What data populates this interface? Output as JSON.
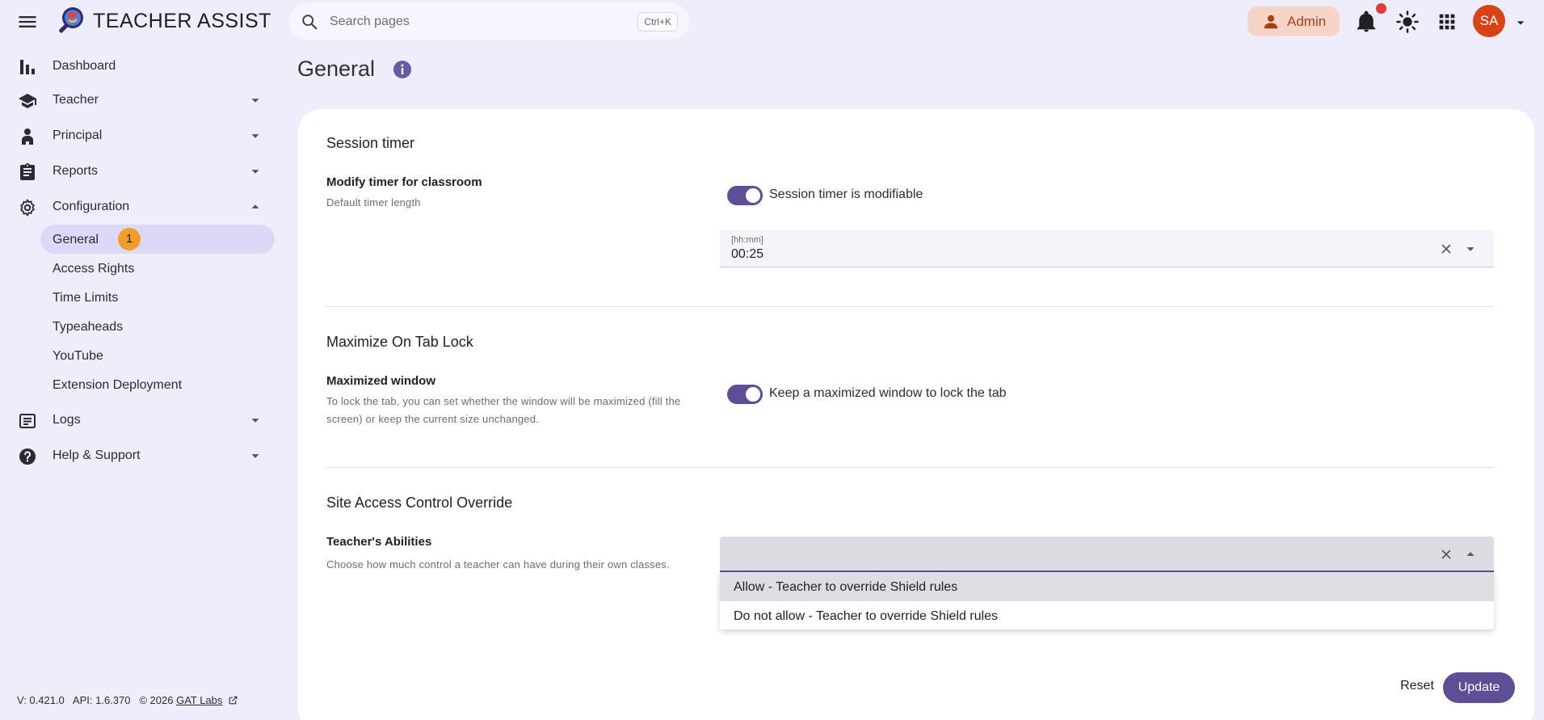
{
  "app": {
    "brand": "TEACHER ASSIST",
    "search_placeholder": "Search pages",
    "search_shortcut": "Ctrl+K",
    "role_label": "Admin",
    "avatar_initials": "SA",
    "icons": [
      "menu-icon",
      "app-logo-icon",
      "search-icon",
      "person-icon",
      "bell-icon",
      "sun-icon",
      "apps-grid-icon",
      "chevron-down-icon"
    ],
    "colors": {
      "accent": "#5d4e95",
      "admin_chip": "#f6d5c8",
      "avatar": "#d84315",
      "badge": "#f59c2a",
      "notification_dot": "#e53935",
      "background": "#eeedfb"
    }
  },
  "sidebar": {
    "items": [
      {
        "label": "Dashboard",
        "icon": "bar-chart-icon"
      },
      {
        "label": "Teacher",
        "icon": "school-icon",
        "expandable": true
      },
      {
        "label": "Principal",
        "icon": "principal-icon",
        "expandable": true
      },
      {
        "label": "Reports",
        "icon": "clipboard-icon",
        "expandable": true
      },
      {
        "label": "Configuration",
        "icon": "gear-icon",
        "expanded": true
      }
    ],
    "sub_items": [
      {
        "label": "General",
        "badge": "1",
        "active": true
      },
      {
        "label": "Access Rights"
      },
      {
        "label": "Time Limits"
      },
      {
        "label": "Typeaheads"
      },
      {
        "label": "YouTube"
      },
      {
        "label": "Extension Deployment"
      }
    ],
    "bottom_items": [
      {
        "label": "Logs",
        "icon": "list-icon",
        "expandable": true
      },
      {
        "label": "Help & Support",
        "icon": "help-icon",
        "expandable": true
      }
    ],
    "footer": {
      "version": "V: 0.421.0",
      "api": "API: 1.6.370",
      "copyright": "© 2026",
      "company_link": "GAT Labs"
    }
  },
  "main": {
    "title": "General",
    "sections": [
      {
        "title": "Session timer",
        "label": "Modify timer for classroom",
        "description": "Default timer length",
        "toggle_label": "Session timer is modifiable",
        "toggle_on": true,
        "field_sublabel": "[hh:mm]",
        "field_value": "00:25"
      },
      {
        "title": "Maximize On Tab Lock",
        "label": "Maximized window",
        "description": "To lock the tab, you can set whether the window will be maximized (fill the screen) or keep the current size unchanged.",
        "toggle_label": "Keep a maximized window to lock the tab",
        "toggle_on": true
      },
      {
        "title": "Site Access Control Override",
        "label": "Teacher's Abilities",
        "description": "Choose how much control a teacher can have during their own classes.",
        "dropdown_options": [
          "Allow - Teacher to override Shield rules",
          "Do not allow - Teacher to override Shield rules"
        ]
      }
    ],
    "actions": {
      "reset": "Reset",
      "update": "Update"
    }
  }
}
